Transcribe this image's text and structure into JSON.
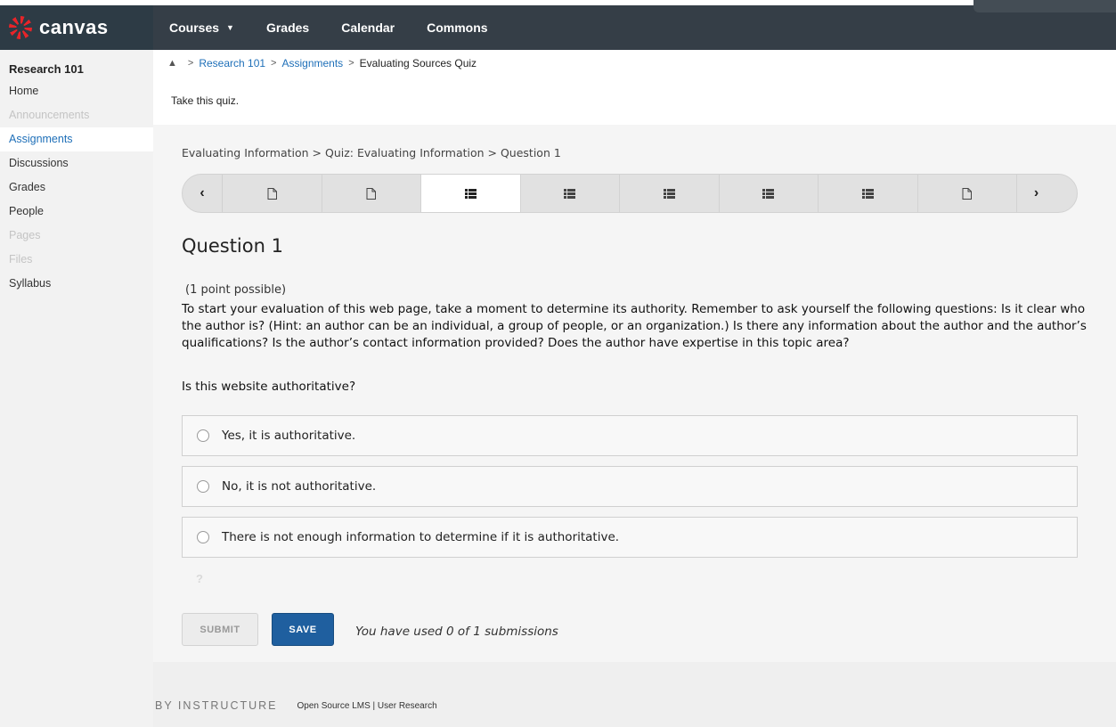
{
  "app": {
    "logo_text": "canvas"
  },
  "nav": {
    "items": [
      {
        "label": "Courses",
        "has_caret": true
      },
      {
        "label": "Grades"
      },
      {
        "label": "Calendar"
      },
      {
        "label": "Commons"
      }
    ]
  },
  "sidebar": {
    "course_title": "Research 101",
    "items": [
      {
        "label": "Home",
        "state": "normal"
      },
      {
        "label": "Announcements",
        "state": "disabled"
      },
      {
        "label": "Assignments",
        "state": "active"
      },
      {
        "label": "Discussions",
        "state": "normal"
      },
      {
        "label": "Grades",
        "state": "normal"
      },
      {
        "label": "People",
        "state": "normal"
      },
      {
        "label": "Pages",
        "state": "disabled"
      },
      {
        "label": "Files",
        "state": "disabled"
      },
      {
        "label": "Syllabus",
        "state": "normal"
      }
    ]
  },
  "breadcrumb": {
    "items": [
      "Research 101",
      "Assignments",
      "Evaluating Sources Quiz"
    ],
    "description": "Take this quiz."
  },
  "quiz": {
    "unit_breadcrumb": "Evaluating Information > Quiz: Evaluating Information > Question 1",
    "nav_slots": [
      "page-icon",
      "page-icon",
      "list-icon",
      "list-icon",
      "list-icon",
      "list-icon",
      "list-icon",
      "page-icon"
    ],
    "current_slot": 3,
    "question_title": "Question 1",
    "points": "(1 point possible)",
    "prompt": "To start your evaluation of this web page, take a moment to determine its authority. Remember to ask yourself the following questions: Is it clear who the author is? (Hint: an author can be an individual, a group of people, or an organization.) Is there any information about the author and the author’s qualifications? Is the author’s contact information provided? Does the author have expertise in this topic area?",
    "ask": "Is this website authoritative?",
    "options": [
      "Yes, it is authoritative.",
      "No, it is not authoritative.",
      "There is not enough information to determine if it is authoritative."
    ],
    "help_glyph": "?",
    "submit_label": "SUBMIT",
    "save_label": "SAVE",
    "submissions_text": "You have used 0 of 1 submissions"
  },
  "footer": {
    "brand": "BY INSTRUCTURE",
    "links": "Open Source LMS | User Research"
  },
  "colors": {
    "topbar": "#353e47",
    "logo_red": "#e72429",
    "link_blue": "#1e6fb8",
    "save_button": "#1f5f9f"
  }
}
